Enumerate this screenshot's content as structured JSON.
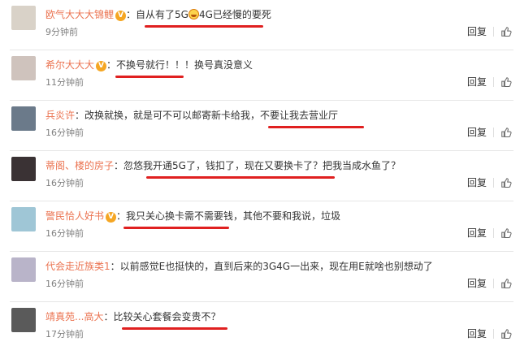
{
  "comments": [
    {
      "user": "欧气大大大锦鲤",
      "verified": true,
      "text_before": "自从有了5G",
      "emoji": "grinning-face-emoji",
      "text_after": "4G已经慢的要死",
      "time": "9分钟前",
      "reply": "回复",
      "avatar_color": "#d9d2c8"
    },
    {
      "user": "希尔大大大",
      "verified": true,
      "text": "不换号就行！！！换号真没意义",
      "time": "11分钟前",
      "reply": "回复",
      "avatar_color": "#cfc3bd"
    },
    {
      "user": "兵炎许",
      "verified": false,
      "text": "改换就换，就是可不可以邮寄新卡给我，不要让我去营业厅",
      "time": "16分钟前",
      "reply": "回复",
      "avatar_color": "#6b7a8a"
    },
    {
      "user": "蒂阁、楼的房子",
      "verified": false,
      "text": "忽悠我开通5G了，钱扣了，现在又要换卡了？把我当成水鱼了？",
      "time": "16分钟前",
      "reply": "回复",
      "avatar_color": "#3a3234"
    },
    {
      "user": "警民恰人好书",
      "verified": true,
      "text": "我只关心换卡需不需要钱，其他不要和我说，垃圾",
      "time": "16分钟前",
      "reply": "回复",
      "avatar_color": "#9fc6d6"
    },
    {
      "user": "代会走近族类1",
      "verified": false,
      "text": "以前感觉E也挺快的，直到后来的3G4G一出来，现在用E就啥也别想动了",
      "time": "16分钟前",
      "reply": "回复",
      "avatar_color": "#b9b4c9"
    },
    {
      "user": "靖真苑...高大",
      "verified": false,
      "text": "比较关心套餐会变贵不？",
      "time": "17分钟前",
      "reply": "回复",
      "avatar_color": "#5a5a5a"
    }
  ]
}
